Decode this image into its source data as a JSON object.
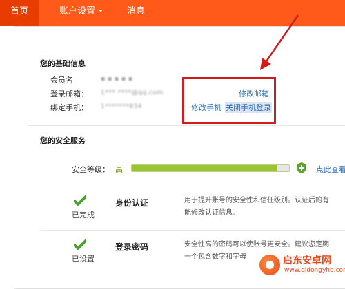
{
  "nav": {
    "home": "首页",
    "account_settings": "账户设置",
    "messages": "消息"
  },
  "basic_info": {
    "title": "您的基础信息",
    "member_name_label": "会员名",
    "member_name_value": "▪ ▪ ▪ ▪ ▪",
    "email_label": "登录邮箱：",
    "email_value": "1*** ****@qq.com",
    "phone_label": "绑定手机：",
    "phone_value": "1*******834",
    "edit_email": "修改邮箱",
    "edit_phone": "修改手机",
    "disable_phone_login": "关闭手机登录"
  },
  "security": {
    "title": "您的安全服务",
    "level_label": "安全等级：",
    "level_value": "高",
    "level_fraction": 0.92,
    "view_details": "点此查看",
    "rows": [
      {
        "status": "已完成",
        "name": "身份认证",
        "desc_line1": "用于提升账号的安全性和信任级别。认证后的有",
        "desc_line2": "能修改认证信息。"
      },
      {
        "status": "已设置",
        "name": "登录密码",
        "desc_line1": "安全性高的密码可以使账号更安全。建议您定期",
        "desc_line2": "一个包含数字和字母"
      }
    ]
  },
  "colors": {
    "nav_bg": "#ff5a1a",
    "link": "#2c6fb7",
    "annotation": "#d41a1a",
    "bar_fill": "#9ac531"
  },
  "watermark": {
    "name": "启东安卓网",
    "url": "www.qidongyhb.com"
  }
}
